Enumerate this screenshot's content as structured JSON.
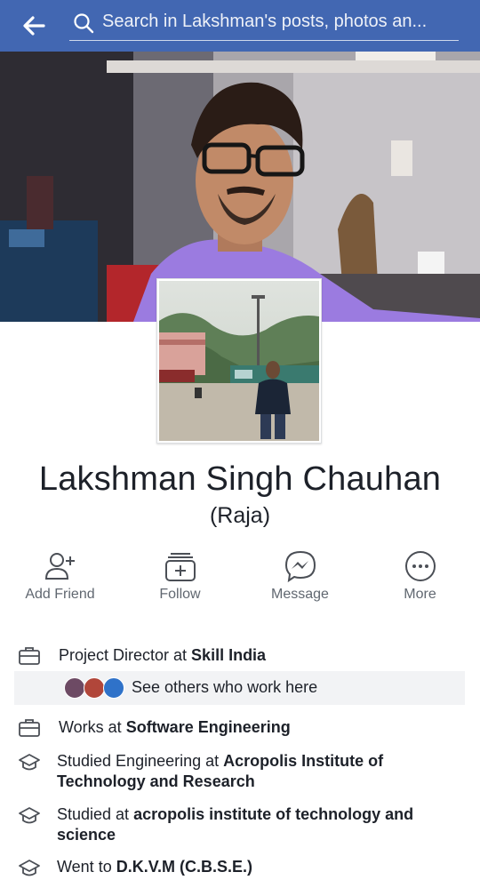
{
  "header": {
    "back_icon": "back-arrow-icon",
    "search_icon": "search-icon",
    "search_text": "Search in Lakshman's posts, photos an...",
    "bg_color": "#4267b2"
  },
  "profile": {
    "name": "Lakshman Singh Chauhan",
    "nickname": "(Raja)"
  },
  "actions": [
    {
      "label": "Add Friend",
      "icon": "add-friend-icon"
    },
    {
      "label": "Follow",
      "icon": "follow-icon"
    },
    {
      "label": "Message",
      "icon": "messenger-icon"
    },
    {
      "label": "More",
      "icon": "more-icon"
    }
  ],
  "about": {
    "work1": {
      "prefix": "Project Director at ",
      "bold": "Skill India",
      "icon": "briefcase-icon"
    },
    "see_others": "See others who work here",
    "work2": {
      "prefix": "Works at ",
      "bold": "Software Engineering",
      "icon": "briefcase-icon"
    },
    "edu1": {
      "prefix": "Studied Engineering at ",
      "bold": "Acropolis Institute of Technology and Research",
      "icon": "graduation-cap-icon"
    },
    "edu2": {
      "prefix": "Studied at ",
      "bold": "acropolis institute of technology and science",
      "icon": "graduation-cap-icon"
    },
    "edu3": {
      "prefix": "Went to ",
      "bold": "D.K.V.M (C.B.S.E.)",
      "icon": "graduation-cap-icon"
    }
  }
}
